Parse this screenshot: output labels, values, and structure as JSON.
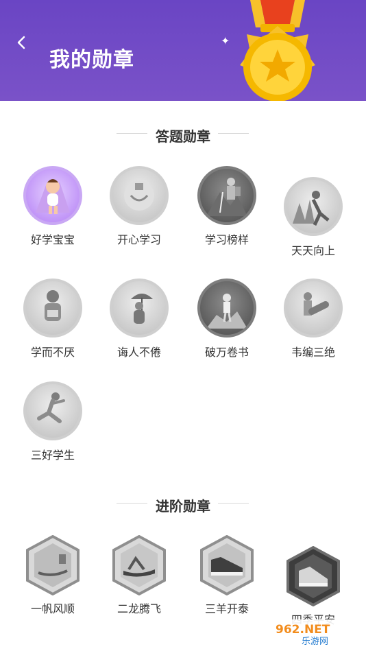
{
  "header": {
    "title": "我的勋章",
    "back_icon": "chevron-left-icon"
  },
  "sections": [
    {
      "title": "答题勋章",
      "badges": [
        {
          "label": "好学宝宝",
          "state": "color"
        },
        {
          "label": "开心学习",
          "state": "gray"
        },
        {
          "label": "学习榜样",
          "state": "dark"
        },
        {
          "label": "天天向上",
          "state": "gray"
        },
        {
          "label": "学而不厌",
          "state": "gray"
        },
        {
          "label": "诲人不倦",
          "state": "gray"
        },
        {
          "label": "破万卷书",
          "state": "dark"
        },
        {
          "label": "韦编三绝",
          "state": "gray"
        },
        {
          "label": "三好学生",
          "state": "gray"
        }
      ]
    },
    {
      "title": "进阶勋章",
      "badges": [
        {
          "label": "一帆风顺",
          "state": "gray"
        },
        {
          "label": "二龙腾飞",
          "state": "gray"
        },
        {
          "label": "三羊开泰",
          "state": "gray"
        },
        {
          "label": "四季平安",
          "state": "dark"
        }
      ]
    }
  ],
  "watermark": {
    "top": "962.NET",
    "bottom": "乐游网"
  },
  "colors": {
    "header": "#6a45c4",
    "gold": "#f5b800"
  }
}
